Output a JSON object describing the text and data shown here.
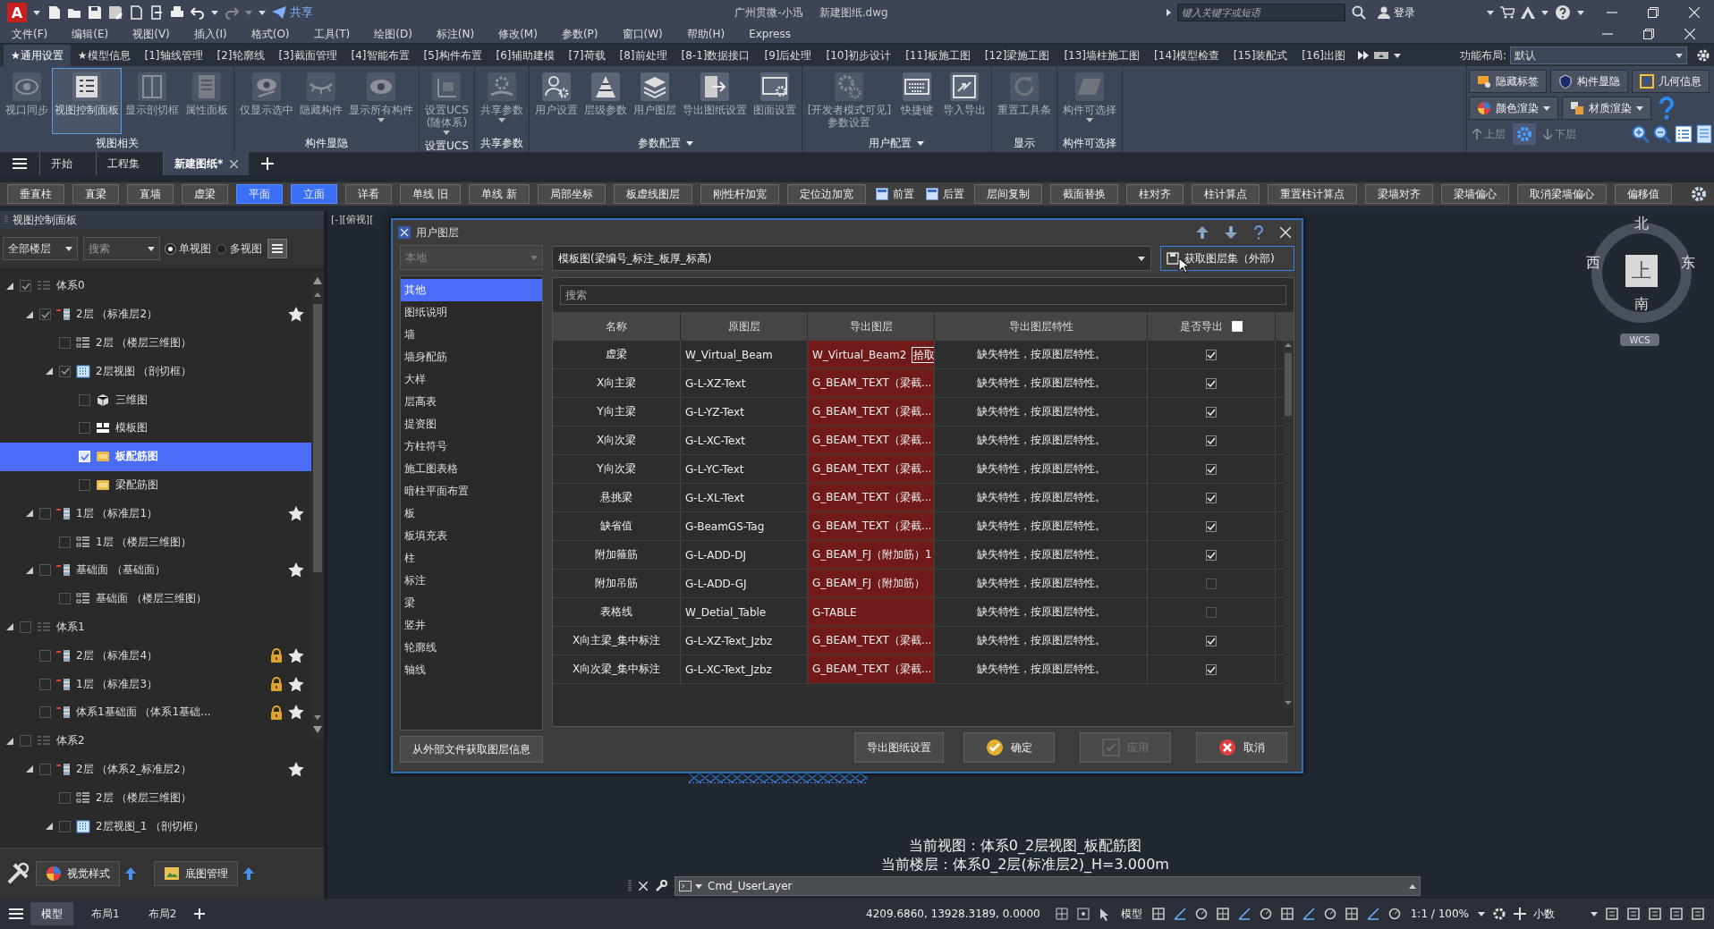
{
  "title_bar": {
    "logo": "A",
    "share": "共享",
    "app_name": "广州贯微-小迅",
    "file_name": "新建图纸.dwg",
    "search": {
      "placeholder": "键入关键字或短语"
    },
    "login": "登录"
  },
  "menu": [
    "文件(F)",
    "编辑(E)",
    "视图(V)",
    "插入(I)",
    "格式(O)",
    "工具(T)",
    "绘图(D)",
    "标注(N)",
    "修改(M)",
    "参数(P)",
    "窗口(W)",
    "帮助(H)",
    "Express"
  ],
  "ribbon_tabs": [
    {
      "label": "★通用设置",
      "selected": true
    },
    {
      "label": "★模型信息",
      "selected": false
    },
    {
      "label": "[1]轴线管理",
      "selected": false
    },
    {
      "label": "[2]轮廓线",
      "selected": false
    },
    {
      "label": "[3]截面管理",
      "selected": false
    },
    {
      "label": "[4]智能布置",
      "selected": false
    },
    {
      "label": "[5]构件布置",
      "selected": false
    },
    {
      "label": "[6]辅助建模",
      "selected": false
    },
    {
      "label": "[7]荷载",
      "selected": false
    },
    {
      "label": "[8]前处理",
      "selected": false
    },
    {
      "label": "[8-1]数据接口",
      "selected": false
    },
    {
      "label": "[9]后处理",
      "selected": false
    },
    {
      "label": "[10]初步设计",
      "selected": false
    },
    {
      "label": "[11]板施工图",
      "selected": false
    },
    {
      "label": "[12]梁施工图",
      "selected": false
    },
    {
      "label": "[13]墙柱施工图",
      "selected": false
    },
    {
      "label": "[14]模型检查",
      "selected": false
    },
    {
      "label": "[15]装配式",
      "selected": false
    },
    {
      "label": "[16]出图",
      "selected": false
    }
  ],
  "layout": {
    "label": "功能布局:",
    "value": "默认"
  },
  "ribbon_groups": [
    {
      "title": "视图相关",
      "menu": false,
      "items": [
        {
          "label": "视口同步",
          "disabled": true,
          "selected": false,
          "dropdown": false
        },
        {
          "label": "视图控制面板",
          "disabled": false,
          "selected": true,
          "dropdown": false
        },
        {
          "label": "显示剖切框",
          "disabled": true,
          "selected": false,
          "dropdown": false
        },
        {
          "label": "属性面板",
          "disabled": true,
          "selected": false,
          "dropdown": false
        }
      ]
    },
    {
      "title": "构件显隐",
      "menu": false,
      "items": [
        {
          "label": "仅显示选中",
          "disabled": true,
          "selected": false,
          "dropdown": false
        },
        {
          "label": "隐藏构件",
          "disabled": true,
          "selected": false,
          "dropdown": false
        },
        {
          "label": "显示所有构件",
          "disabled": true,
          "selected": false,
          "dropdown": true
        }
      ]
    },
    {
      "title": "设置UCS",
      "menu": false,
      "items": [
        {
          "label": "设置UCS\n(随体系)",
          "disabled": true,
          "selected": false,
          "dropdown": true
        }
      ]
    },
    {
      "title": "共享参数",
      "menu": false,
      "items": [
        {
          "label": "共享参数",
          "disabled": true,
          "selected": false,
          "dropdown": true
        }
      ]
    },
    {
      "title": "参数配置",
      "menu": true,
      "items": [
        {
          "label": "用户设置",
          "disabled": false,
          "selected": false,
          "dropdown": false
        },
        {
          "label": "层级参数",
          "disabled": false,
          "selected": false,
          "dropdown": false
        },
        {
          "label": "用户图层",
          "disabled": false,
          "selected": false,
          "dropdown": false
        },
        {
          "label": "导出图纸设置",
          "disabled": false,
          "selected": false,
          "dropdown": false
        },
        {
          "label": "图面设置",
          "disabled": false,
          "selected": false,
          "dropdown": false
        }
      ]
    },
    {
      "title": "用户配置",
      "menu": true,
      "items": [
        {
          "label": "[开发者模式可见]\n参数设置",
          "disabled": true,
          "selected": false,
          "dropdown": false
        },
        {
          "label": "快捷键",
          "disabled": false,
          "selected": false,
          "dropdown": false
        },
        {
          "label": "导入导出",
          "disabled": false,
          "selected": false,
          "dropdown": false
        }
      ]
    },
    {
      "title": "显示",
      "menu": false,
      "items": [
        {
          "label": "重置工具条",
          "disabled": true,
          "selected": false,
          "dropdown": false
        }
      ]
    },
    {
      "title": "构件可选择",
      "menu": false,
      "items": [
        {
          "label": "构件可选择",
          "disabled": true,
          "selected": false,
          "dropdown": true
        }
      ]
    }
  ],
  "quick_panel": {
    "buttons": [
      {
        "label": "隐藏标签",
        "dropdown": false
      },
      {
        "label": "构件显隐",
        "dropdown": false
      },
      {
        "label": "几何信息",
        "dropdown": false
      },
      {
        "label": "颜色渲染",
        "dropdown": true
      },
      {
        "label": "材质渲染",
        "dropdown": true
      }
    ],
    "up": {
      "label": "上层",
      "disabled": true
    },
    "down": {
      "label": "下层",
      "disabled": true
    }
  },
  "doc_tabs": [
    {
      "label": "开始",
      "selected": false
    },
    {
      "label": "工程集",
      "selected": false
    },
    {
      "label": "新建图纸*",
      "selected": true
    }
  ],
  "toolbar": [
    {
      "label": "垂直柱",
      "kind": "button",
      "selected": false
    },
    {
      "label": "直梁",
      "kind": "button",
      "selected": false
    },
    {
      "label": "直墙",
      "kind": "button",
      "selected": false
    },
    {
      "label": "虚梁",
      "kind": "button",
      "selected": false
    },
    {
      "label": "平面",
      "kind": "button",
      "selected": true
    },
    {
      "label": "立面",
      "kind": "button",
      "selected": true
    },
    {
      "label": "详看",
      "kind": "button",
      "selected": false
    },
    {
      "label": "单线 旧",
      "kind": "button",
      "selected": false
    },
    {
      "label": "单线 新",
      "kind": "button",
      "selected": false
    },
    {
      "label": "局部坐标",
      "kind": "button",
      "selected": false
    },
    {
      "label": "板虚线图层",
      "kind": "button",
      "selected": false
    },
    {
      "label": "刚性杆加宽",
      "kind": "button",
      "selected": false
    },
    {
      "label": "定位边加宽",
      "kind": "button",
      "selected": false
    },
    {
      "label": "前置",
      "kind": "icon",
      "selected": false
    },
    {
      "label": "后置",
      "kind": "icon",
      "selected": false
    },
    {
      "label": "层间复制",
      "kind": "button",
      "selected": false
    },
    {
      "label": "截面替换",
      "kind": "button",
      "selected": false
    },
    {
      "label": "柱对齐",
      "kind": "button",
      "selected": false
    },
    {
      "label": "柱计算点",
      "kind": "button",
      "selected": false
    },
    {
      "label": "重置柱计算点",
      "kind": "button",
      "selected": false
    },
    {
      "label": "梁墙对齐",
      "kind": "button",
      "selected": false
    },
    {
      "label": "梁墙偏心",
      "kind": "button",
      "selected": false
    },
    {
      "label": "取消梁墙偏心",
      "kind": "button",
      "selected": false
    },
    {
      "label": "偏移值",
      "kind": "button",
      "selected": false
    }
  ],
  "view_panel": {
    "title": "视图控制面板",
    "floor_filter": "全部楼层",
    "search": {
      "placeholder": "搜索"
    },
    "modes": [
      {
        "label": "单视图",
        "selected": true
      },
      {
        "label": "多视图",
        "selected": false
      }
    ],
    "tree": [
      {
        "label": "体系0",
        "kind": "system",
        "checked": true,
        "expanded": true,
        "selected": false,
        "starred": false,
        "locked": false,
        "children": [
          {
            "label": "2层 （标准层2）",
            "kind": "floor",
            "checked": true,
            "expanded": true,
            "selected": false,
            "starred": true,
            "locked": false,
            "children": [
              {
                "label": "2层 （楼层三维图）",
                "kind": "floor3d",
                "checked": false,
                "expanded": false,
                "selected": false,
                "starred": false,
                "locked": false
              },
              {
                "label": "2层视图 （剖切框）",
                "kind": "section",
                "checked": true,
                "expanded": true,
                "selected": false,
                "starred": false,
                "locked": false,
                "children": [
                  {
                    "label": "三维图",
                    "kind": "model3d",
                    "checked": false,
                    "expanded": false,
                    "selected": false,
                    "starred": false,
                    "locked": false
                  },
                  {
                    "label": "模板图",
                    "kind": "template",
                    "checked": false,
                    "expanded": false,
                    "selected": false,
                    "starred": false,
                    "locked": false
                  },
                  {
                    "label": "板配筋图",
                    "kind": "rebar",
                    "checked": true,
                    "expanded": false,
                    "selected": true,
                    "starred": false,
                    "locked": false
                  },
                  {
                    "label": "梁配筋图",
                    "kind": "rebar",
                    "checked": false,
                    "expanded": false,
                    "selected": false,
                    "starred": false,
                    "locked": false
                  }
                ]
              }
            ]
          },
          {
            "label": "1层 （标准层1）",
            "kind": "floor",
            "checked": false,
            "expanded": true,
            "selected": false,
            "starred": true,
            "locked": false,
            "children": [
              {
                "label": "1层 （楼层三维图）",
                "kind": "floor3d",
                "checked": false,
                "expanded": false,
                "selected": false,
                "starred": false,
                "locked": false
              }
            ]
          },
          {
            "label": "基础面 （基础面）",
            "kind": "floor",
            "checked": false,
            "expanded": true,
            "selected": false,
            "starred": true,
            "locked": false,
            "children": [
              {
                "label": "基础面 （楼层三维图）",
                "kind": "floor3d",
                "checked": false,
                "expanded": false,
                "selected": false,
                "starred": false,
                "locked": false
              }
            ]
          }
        ]
      },
      {
        "label": "体系1",
        "kind": "system",
        "checked": false,
        "expanded": true,
        "selected": false,
        "starred": false,
        "locked": false,
        "children": [
          {
            "label": "2层 （标准层4）",
            "kind": "floor",
            "checked": false,
            "expanded": false,
            "selected": false,
            "starred": true,
            "locked": true
          },
          {
            "label": "1层 （标准层3）",
            "kind": "floor",
            "checked": false,
            "expanded": false,
            "selected": false,
            "starred": true,
            "locked": true
          },
          {
            "label": "体系1基础面 （体系1基础...",
            "kind": "floor",
            "checked": false,
            "expanded": false,
            "selected": false,
            "starred": true,
            "locked": true
          }
        ]
      },
      {
        "label": "体系2",
        "kind": "system",
        "checked": false,
        "expanded": true,
        "selected": false,
        "starred": false,
        "locked": false,
        "children": [
          {
            "label": "2层 （体系2_标准层2）",
            "kind": "floor",
            "checked": false,
            "expanded": true,
            "selected": false,
            "starred": true,
            "locked": false,
            "children": [
              {
                "label": "2层 （楼层三维图）",
                "kind": "floor3d",
                "checked": false,
                "expanded": false,
                "selected": false,
                "starred": false,
                "locked": false
              },
              {
                "label": "2层视图_1 （剖切框）",
                "kind": "section",
                "checked": false,
                "expanded": true,
                "selected": false,
                "starred": false,
                "locked": false
              }
            ]
          }
        ]
      }
    ],
    "bottom_buttons": [
      {
        "label": "视觉样式"
      },
      {
        "label": "底图管理"
      }
    ]
  },
  "viewport": {
    "label": "[-][俯视][",
    "compass": {
      "north": "北",
      "south": "南",
      "east": "东",
      "west": "西",
      "face": "上",
      "ucs": "WCS"
    },
    "current_view": "当前视图：体系0_2层视图_板配筋图",
    "current_floor": "当前楼层：体系0_2层(标准层2)_H=3.000m"
  },
  "dialog": {
    "title": "用户图层",
    "source": {
      "value": "本地",
      "disabled": true
    },
    "layer_set": "模板图(梁编号_标注_板厚_标高)",
    "fetch_button": "获取图层集（外部)",
    "search": {
      "placeholder": "搜索"
    },
    "categories": [
      {
        "label": "其他",
        "selected": true
      },
      {
        "label": "图纸说明",
        "selected": false
      },
      {
        "label": "墙",
        "selected": false
      },
      {
        "label": "墙身配筋",
        "selected": false
      },
      {
        "label": "大样",
        "selected": false
      },
      {
        "label": "层高表",
        "selected": false
      },
      {
        "label": "提资图",
        "selected": false
      },
      {
        "label": "方柱符号",
        "selected": false
      },
      {
        "label": "施工图表格",
        "selected": false
      },
      {
        "label": "暗柱平面布置",
        "selected": false
      },
      {
        "label": "板",
        "selected": false
      },
      {
        "label": "板填充表",
        "selected": false
      },
      {
        "label": "柱",
        "selected": false
      },
      {
        "label": "标注",
        "selected": false
      },
      {
        "label": "梁",
        "selected": false
      },
      {
        "label": "竖井",
        "selected": false
      },
      {
        "label": "轮廓线",
        "selected": false
      },
      {
        "label": "轴线",
        "selected": false
      }
    ],
    "columns": [
      "名称",
      "原图层",
      "导出图层",
      "导出图层特性",
      "是否导出"
    ],
    "export_all": false,
    "rows": [
      {
        "name": "虚梁",
        "source_layer": "W_Virtual_Beam",
        "export_layer": "W_Virtual_Beam2",
        "pick": "拾取",
        "property": "缺失特性，按原图层特性。",
        "export": true
      },
      {
        "name": "X向主梁",
        "source_layer": "G-L-XZ-Text",
        "export_layer": "G_BEAM_TEXT（梁截...",
        "property": "缺失特性，按原图层特性。",
        "export": true
      },
      {
        "name": "Y向主梁",
        "source_layer": "G-L-YZ-Text",
        "export_layer": "G_BEAM_TEXT（梁截...",
        "property": "缺失特性，按原图层特性。",
        "export": true
      },
      {
        "name": "X向次梁",
        "source_layer": "G-L-XC-Text",
        "export_layer": "G_BEAM_TEXT（梁截...",
        "property": "缺失特性，按原图层特性。",
        "export": true
      },
      {
        "name": "Y向次梁",
        "source_layer": "G-L-YC-Text",
        "export_layer": "G_BEAM_TEXT（梁截...",
        "property": "缺失特性，按原图层特性。",
        "export": true
      },
      {
        "name": "悬挑梁",
        "source_layer": "G-L-XL-Text",
        "export_layer": "G_BEAM_TEXT（梁截...",
        "property": "缺失特性，按原图层特性。",
        "export": true
      },
      {
        "name": "缺省值",
        "source_layer": "G-BeamGS-Tag",
        "export_layer": "G_BEAM_TEXT（梁截...",
        "property": "缺失特性，按原图层特性。",
        "export": true
      },
      {
        "name": "附加箍筋",
        "source_layer": "G-L-ADD-DJ",
        "export_layer": "G_BEAM_FJ（附加筋）1",
        "property": "缺失特性，按原图层特性。",
        "export": true
      },
      {
        "name": "附加吊筋",
        "source_layer": "G-L-ADD-GJ",
        "export_layer": "G_BEAM_FJ（附加筋）",
        "property": "缺失特性，按原图层特性。",
        "export": false
      },
      {
        "name": "表格线",
        "source_layer": "W_Detial_Table",
        "export_layer": "G-TABLE",
        "property": "缺失特性，按原图层特性。",
        "export": false
      },
      {
        "name": "X向主梁_集中标注",
        "source_layer": "G-L-XZ-Text_Jzbz",
        "export_layer": "G_BEAM_TEXT（梁截...",
        "property": "缺失特性，按原图层特性。",
        "export": true
      },
      {
        "name": "X向次梁_集中标注",
        "source_layer": "G-L-XC-Text_Jzbz",
        "export_layer": "G_BEAM_TEXT（梁截...",
        "property": "缺失特性，按原图层特性。",
        "export": true
      }
    ],
    "import_button": "从外部文件获取图层信息",
    "buttons": [
      {
        "label": "导出图纸设置",
        "kind": "plain",
        "disabled": false
      },
      {
        "label": "确定",
        "kind": "ok",
        "disabled": false
      },
      {
        "label": "应用",
        "kind": "apply",
        "disabled": true
      },
      {
        "label": "取消",
        "kind": "cancel",
        "disabled": false
      }
    ]
  },
  "command_line": {
    "value": "Cmd_UserLayer"
  },
  "status_bar": {
    "layout_tabs": [
      {
        "label": "模型",
        "selected": true
      },
      {
        "label": "布局1",
        "selected": false
      },
      {
        "label": "布局2",
        "selected": false
      }
    ],
    "coordinates": "4209.6860, 13928.3189, 0.0000",
    "space": "模型",
    "scale": "1:1 / 100%",
    "units": "小数"
  }
}
